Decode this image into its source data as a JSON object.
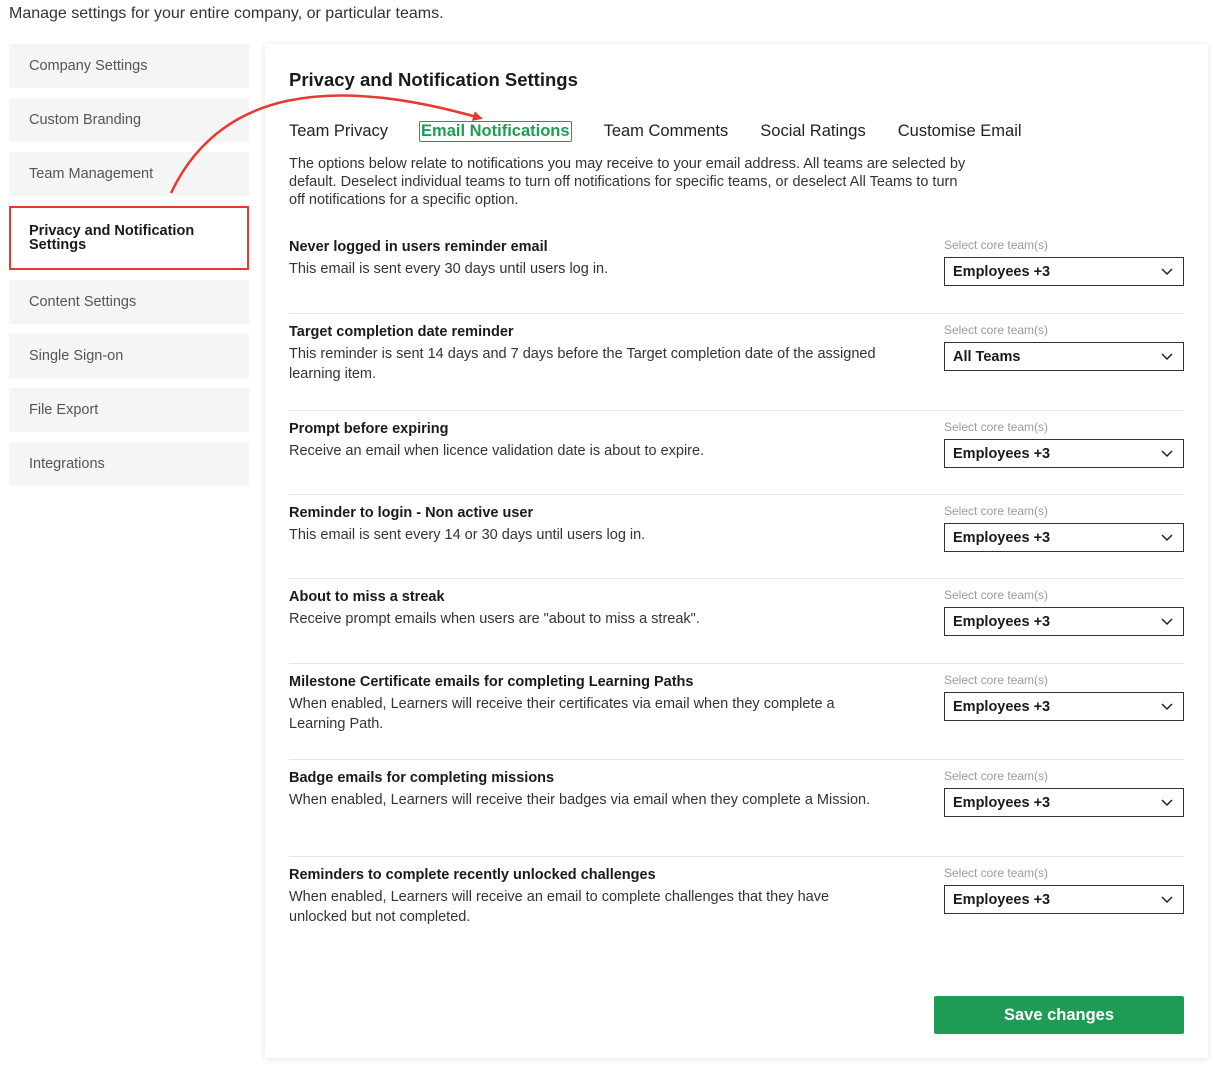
{
  "intro": "Manage settings for your entire company, or particular teams.",
  "sidebar": {
    "items": [
      {
        "label": "Company Settings"
      },
      {
        "label": "Custom Branding"
      },
      {
        "label": "Team Management"
      },
      {
        "label": "Privacy and Notification Settings",
        "active": true
      },
      {
        "label": "Content Settings"
      },
      {
        "label": "Single Sign-on"
      },
      {
        "label": "File Export"
      },
      {
        "label": "Integrations"
      }
    ]
  },
  "panel": {
    "title": "Privacy and Notification Settings",
    "tabs": [
      {
        "label": "Team Privacy"
      },
      {
        "label": "Email Notifications",
        "active": true
      },
      {
        "label": "Team Comments"
      },
      {
        "label": "Social Ratings"
      },
      {
        "label": "Customise Email"
      }
    ],
    "description": "The options below relate to notifications you may receive to your email address. All teams are selected by default. Deselect individual teams to turn off notifications for specific teams, or deselect All Teams to turn off notifications for a specific option."
  },
  "select_label": "Select core team(s)",
  "rows": [
    {
      "title": "Never logged in users reminder email",
      "text": "This email is sent every 30 days until users log in.",
      "value": "Employees +3"
    },
    {
      "title": "Target completion date reminder",
      "text": "This reminder is sent 14 days and 7 days before the Target completion date of the assigned learning item.",
      "value": "All Teams"
    },
    {
      "title": "Prompt before expiring",
      "text": "Receive an email when licence validation date is about to expire.",
      "value": "Employees +3"
    },
    {
      "title": "Reminder to login - Non active user",
      "text": "This email is sent every 14 or 30 days until users log in.",
      "value": "Employees +3"
    },
    {
      "title": "About to miss a streak",
      "text": "Receive prompt emails when users are \"about to miss a streak\".",
      "value": "Employees +3"
    },
    {
      "title": "Milestone Certificate emails for completing Learning Paths",
      "text": "When enabled, Learners will receive their certificates via email when they complete a Learning Path.",
      "value": "Employees +3"
    },
    {
      "title": "Badge emails for completing missions",
      "text": "When enabled, Learners will receive their badges via email when they complete a Mission.",
      "value": "Employees +3"
    },
    {
      "title": "Reminders to complete recently unlocked challenges",
      "text": "When enabled, Learners will receive an email to complete challenges that they have unlocked but not completed.",
      "value": "Employees +3"
    }
  ],
  "save_label": "Save changes",
  "colors": {
    "accent": "#1e9c56",
    "highlight": "#e8392f"
  }
}
